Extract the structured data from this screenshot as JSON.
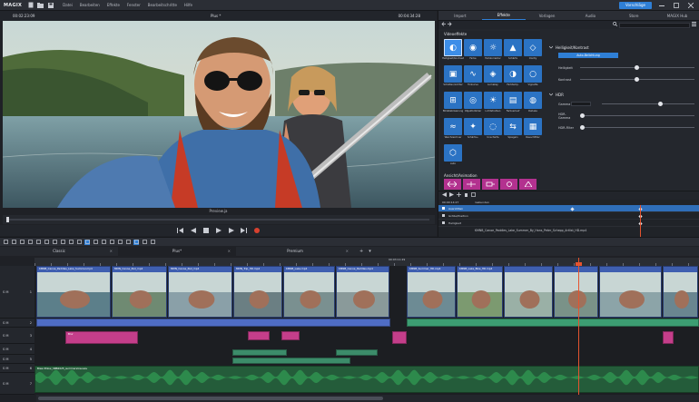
{
  "app": {
    "logo": "MAGIX",
    "menu": [
      "Datei",
      "Bearbeiten",
      "Effekte",
      "Fenster",
      "Bearbeitschritte",
      "Hilfe"
    ],
    "template_button": "Vorschläge"
  },
  "preview": {
    "timecode_left": "00:02:23:09",
    "title": "Plus *",
    "timecode_right": "00:04:34:28",
    "label": "Preview.ja"
  },
  "right_panel": {
    "tabs": [
      "Import",
      "Effekte",
      "Vorlagen",
      "Audio",
      "Store",
      "MAGIX Hub"
    ],
    "active_tab": "Effekte",
    "effects_section": "Videoeffekte",
    "tiles": [
      "Helligkeit/Kontrast",
      "Farbe",
      "Farbkorrektur",
      "Schärfe",
      "Clarity",
      "Schatten/Lichter",
      "Tonkurve",
      "Lumakey",
      "Farbtemp.",
      "Vignette",
      "Bildstabilisierung",
      "Objektivfehler",
      "Lichtstrahlen",
      "Farbverlauf",
      "Dehaze",
      "Weichzeichner",
      "Schärfe+",
      "Unschärfe",
      "Spiegeln",
      "Rauschfilter",
      "Auto"
    ],
    "motion_section": "Ansicht/Animation",
    "props_title": "Helligkeit/Kontrast",
    "auto_button": "Auto-Belichtung",
    "props_rows": [
      {
        "label": "Helligkeit",
        "value": 0.5
      },
      {
        "label": "Kontrast",
        "value": 0.5
      }
    ],
    "section_hdr": "HDR",
    "gamma_label": "Gamma",
    "hdr_rows": [
      {
        "label": "HDR-Gamma",
        "value": 0.0
      },
      {
        "label": "HDR-Filter",
        "value": 0.0
      }
    ],
    "keyframes": {
      "header_left": "00:00:14:27",
      "header_mid": "Gebunden",
      "rows": [
        "Ausrichten",
        "Größe/Position",
        "Helligkeit"
      ],
      "selected_row": "Ausrichten",
      "clip_name": "KMNB_Canoe_Paddles_Lake_Summer_By_Hans_Peter_Schepp_Artlist_HD.mp4"
    }
  },
  "timeline": {
    "tabs": [
      "Classic",
      "Plus*",
      "Premium"
    ],
    "active_tab": "Plus*",
    "ruler_timecode": "00:03:11:29",
    "track_labels": [
      "S M",
      "S M",
      "S M",
      "S M",
      "S M",
      "S M",
      "S M"
    ],
    "track_numbers": [
      "1",
      "2",
      "3",
      "4",
      "5",
      "6",
      "7"
    ],
    "clips_top": [
      "KMNB_Canoe_Paddles_Lake_Summer.mp4",
      "MMN_Canoe_Pad_mp4",
      "MMN_Canoe_Pad_mp4",
      "MMN_Trip_HD.mp4",
      "KMNB_Lake.mp4",
      "KMNB_Canoe_Paddles.mp4",
      "KMNB_Summer_HD.mp4",
      "KMNB_Lake_Bike_HD.mp4"
    ],
    "clip_fx": "Blur",
    "audio_title": "Blew Pillow_SBB2025_summerslow.wav"
  }
}
